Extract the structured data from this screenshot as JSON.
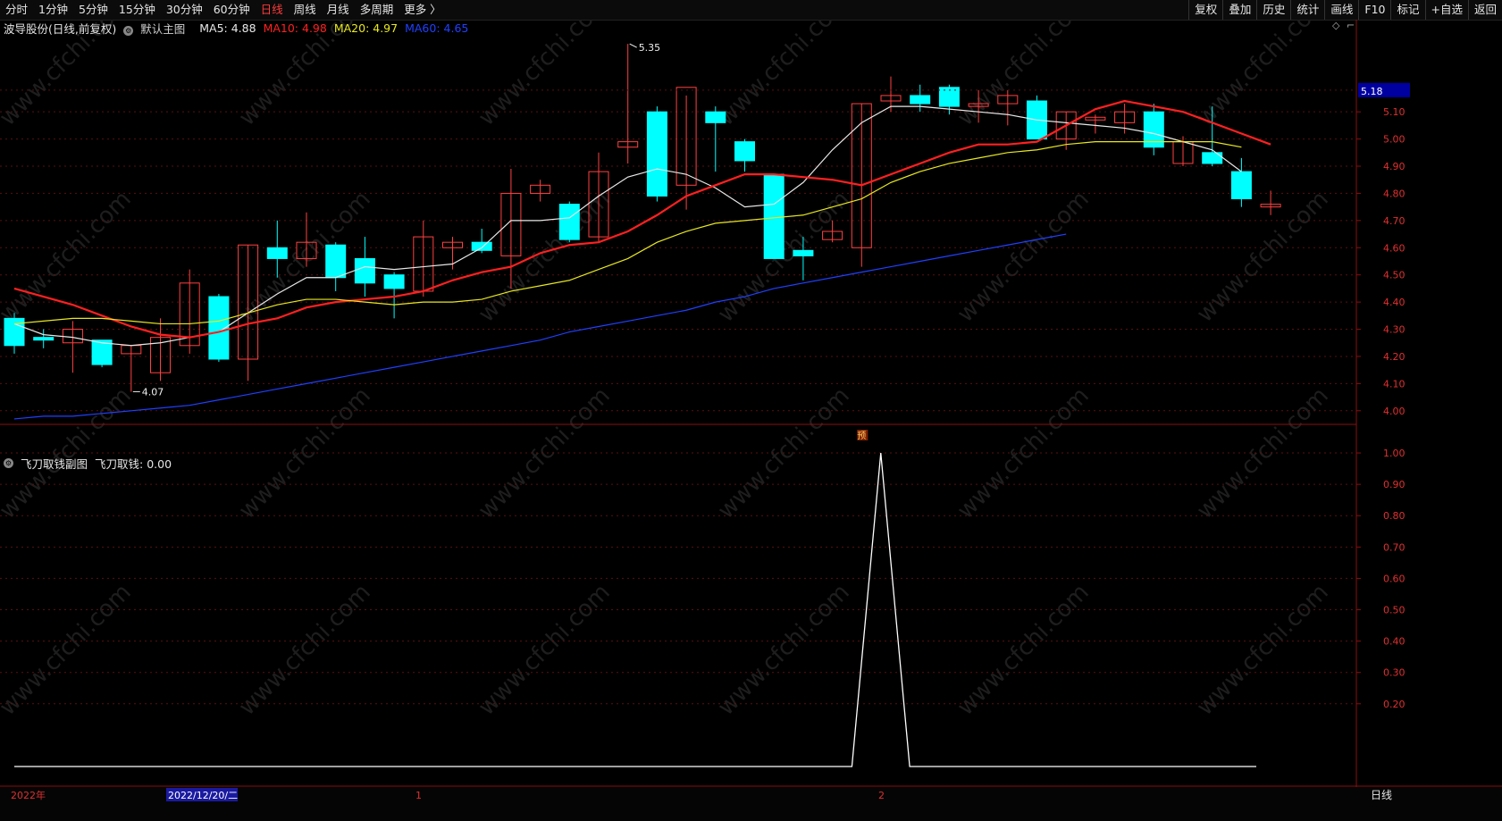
{
  "toolbar": {
    "tabs": [
      {
        "label": "分时",
        "active": false
      },
      {
        "label": "1分钟",
        "active": false
      },
      {
        "label": "5分钟",
        "active": false
      },
      {
        "label": "15分钟",
        "active": false
      },
      {
        "label": "30分钟",
        "active": false
      },
      {
        "label": "60分钟",
        "active": false
      },
      {
        "label": "日线",
        "active": true
      },
      {
        "label": "周线",
        "active": false
      },
      {
        "label": "月线",
        "active": false
      },
      {
        "label": "多周期",
        "active": false
      },
      {
        "label": "更多 〉",
        "active": false
      }
    ],
    "tools": [
      "复权",
      "叠加",
      "历史",
      "统计",
      "画线",
      "F10",
      "标记",
      "+自选",
      "返回"
    ]
  },
  "main_info": {
    "stock": "波导股份(日线,前复权)",
    "chart_name": "默认主图",
    "ma": [
      {
        "label": "MA5: 4.88",
        "color": "#e8e8e8"
      },
      {
        "label": "MA10: 4.98",
        "color": "#ff2020"
      },
      {
        "label": "MA20: 4.97",
        "color": "#e8e820"
      },
      {
        "label": "MA60: 4.65",
        "color": "#2040ff"
      }
    ]
  },
  "sub_info": {
    "chart_name": "飞刀取钱副图",
    "value_label": "飞刀取钱: 0.00"
  },
  "price_badge": "5.18",
  "marker_label": "预",
  "annotations": {
    "high": "5.35",
    "low": "4.07"
  },
  "date_axis": {
    "start": "2022年",
    "cursor": "2022/12/20/二",
    "m1": "1",
    "m2": "2",
    "period": "日线"
  },
  "watermark": "www.cfchi.com",
  "chart_data": [
    {
      "type": "candlestick",
      "ylim": [
        3.95,
        5.38
      ],
      "yticks": [
        4.0,
        4.1,
        4.2,
        4.3,
        4.4,
        4.5,
        4.6,
        4.7,
        4.8,
        4.9,
        5.0,
        5.1
      ],
      "up_color": "#ff4040",
      "down_color": "#00ffff",
      "candles": [
        [
          4.34,
          4.36,
          4.21,
          4.24
        ],
        [
          4.27,
          4.3,
          4.23,
          4.26
        ],
        [
          4.25,
          4.33,
          4.14,
          4.3
        ],
        [
          4.26,
          4.26,
          4.16,
          4.17
        ],
        [
          4.21,
          4.24,
          4.07,
          4.24
        ],
        [
          4.14,
          4.34,
          4.11,
          4.27
        ],
        [
          4.24,
          4.52,
          4.21,
          4.47
        ],
        [
          4.42,
          4.43,
          4.18,
          4.19
        ],
        [
          4.19,
          4.61,
          4.11,
          4.61
        ],
        [
          4.6,
          4.7,
          4.49,
          4.56
        ],
        [
          4.56,
          4.73,
          4.53,
          4.62
        ],
        [
          4.61,
          4.62,
          4.44,
          4.49
        ],
        [
          4.56,
          4.64,
          4.42,
          4.47
        ],
        [
          4.5,
          4.51,
          4.34,
          4.45
        ],
        [
          4.44,
          4.7,
          4.42,
          4.64
        ],
        [
          4.6,
          4.64,
          4.52,
          4.62
        ],
        [
          4.62,
          4.67,
          4.58,
          4.59
        ],
        [
          4.57,
          4.89,
          4.45,
          4.8
        ],
        [
          4.8,
          4.85,
          4.77,
          4.83
        ],
        [
          4.76,
          4.77,
          4.62,
          4.63
        ],
        [
          4.64,
          4.95,
          4.62,
          4.88
        ],
        [
          4.97,
          5.35,
          4.91,
          4.99
        ],
        [
          5.1,
          5.12,
          4.77,
          4.79
        ],
        [
          4.83,
          5.16,
          4.74,
          5.19
        ],
        [
          5.1,
          5.12,
          4.88,
          5.06
        ],
        [
          4.99,
          5.0,
          4.88,
          4.92
        ],
        [
          4.87,
          4.87,
          4.56,
          4.56
        ],
        [
          4.59,
          4.64,
          4.48,
          4.57
        ],
        [
          4.63,
          4.7,
          4.62,
          4.66
        ],
        [
          4.6,
          5.13,
          4.53,
          5.13
        ],
        [
          5.14,
          5.23,
          5.1,
          5.16
        ],
        [
          5.16,
          5.2,
          5.1,
          5.13
        ],
        [
          5.19,
          5.2,
          5.09,
          5.12
        ],
        [
          5.12,
          5.18,
          5.06,
          5.13
        ],
        [
          5.13,
          5.18,
          5.05,
          5.16
        ],
        [
          5.14,
          5.16,
          5.0,
          5.0
        ],
        [
          5.0,
          5.1,
          4.96,
          5.1
        ],
        [
          5.07,
          5.09,
          5.02,
          5.08
        ],
        [
          5.06,
          5.13,
          5.02,
          5.1
        ],
        [
          5.1,
          5.13,
          4.94,
          4.97
        ],
        [
          4.91,
          5.01,
          4.9,
          4.99
        ],
        [
          4.95,
          5.12,
          4.9,
          4.91
        ],
        [
          4.88,
          4.93,
          4.75,
          4.78
        ],
        [
          4.75,
          4.81,
          4.72,
          4.76
        ]
      ],
      "series": [
        {
          "name": "MA5",
          "color": "#e8e8e8",
          "values": [
            4.32,
            4.28,
            4.27,
            4.25,
            4.24,
            4.25,
            4.27,
            4.29,
            4.36,
            4.43,
            4.49,
            4.49,
            4.53,
            4.52,
            4.53,
            4.54,
            4.6,
            4.7,
            4.7,
            4.71,
            4.79,
            4.86,
            4.89,
            4.87,
            4.82,
            4.75,
            4.76,
            4.84,
            4.96,
            5.06,
            5.12,
            5.12,
            5.11,
            5.1,
            5.09,
            5.07,
            5.06,
            5.05,
            5.04,
            5.02,
            4.99,
            4.96,
            4.88
          ]
        },
        {
          "name": "MA10",
          "color": "#ff2020",
          "values": [
            4.45,
            4.42,
            4.39,
            4.35,
            4.31,
            4.28,
            4.27,
            4.29,
            4.32,
            4.34,
            4.38,
            4.4,
            4.41,
            4.42,
            4.44,
            4.48,
            4.51,
            4.53,
            4.58,
            4.61,
            4.62,
            4.66,
            4.72,
            4.79,
            4.83,
            4.87,
            4.87,
            4.86,
            4.85,
            4.83,
            4.87,
            4.91,
            4.95,
            4.98,
            4.98,
            4.99,
            5.05,
            5.11,
            5.14,
            5.12,
            5.1,
            5.06,
            5.02,
            4.98
          ]
        },
        {
          "name": "MA20",
          "color": "#e8e820",
          "values": [
            4.32,
            4.33,
            4.34,
            4.34,
            4.33,
            4.32,
            4.32,
            4.33,
            4.36,
            4.39,
            4.41,
            4.41,
            4.4,
            4.39,
            4.4,
            4.4,
            4.41,
            4.44,
            4.46,
            4.48,
            4.52,
            4.56,
            4.62,
            4.66,
            4.69,
            4.7,
            4.71,
            4.72,
            4.75,
            4.78,
            4.84,
            4.88,
            4.91,
            4.93,
            4.95,
            4.96,
            4.98,
            4.99,
            4.99,
            4.99,
            4.99,
            4.99,
            4.97
          ]
        },
        {
          "name": "MA60",
          "color": "#2040ff",
          "values": [
            3.97,
            3.98,
            3.98,
            3.99,
            4.0,
            4.01,
            4.02,
            4.04,
            4.06,
            4.08,
            4.1,
            4.12,
            4.14,
            4.16,
            4.18,
            4.2,
            4.22,
            4.24,
            4.26,
            4.29,
            4.31,
            4.33,
            4.35,
            4.37,
            4.4,
            4.42,
            4.45,
            4.47,
            4.49,
            4.51,
            4.53,
            4.55,
            4.57,
            4.59,
            4.61,
            4.63,
            4.65
          ]
        }
      ]
    },
    {
      "type": "line",
      "ylim": [
        0,
        1.04
      ],
      "yticks": [
        0.2,
        0.3,
        0.4,
        0.5,
        0.6,
        0.7,
        0.8,
        0.9,
        1.0
      ],
      "series": [
        {
          "name": "飞刀取钱",
          "color": "#ffffff",
          "values": [
            0,
            0,
            0,
            0,
            0,
            0,
            0,
            0,
            0,
            0,
            0,
            0,
            0,
            0,
            0,
            0,
            0,
            0,
            0,
            0,
            0,
            0,
            0,
            0,
            0,
            0,
            0,
            0,
            0,
            0,
            1,
            0,
            0,
            0,
            0,
            0,
            0,
            0,
            0,
            0,
            0,
            0,
            0,
            0
          ]
        }
      ]
    }
  ]
}
